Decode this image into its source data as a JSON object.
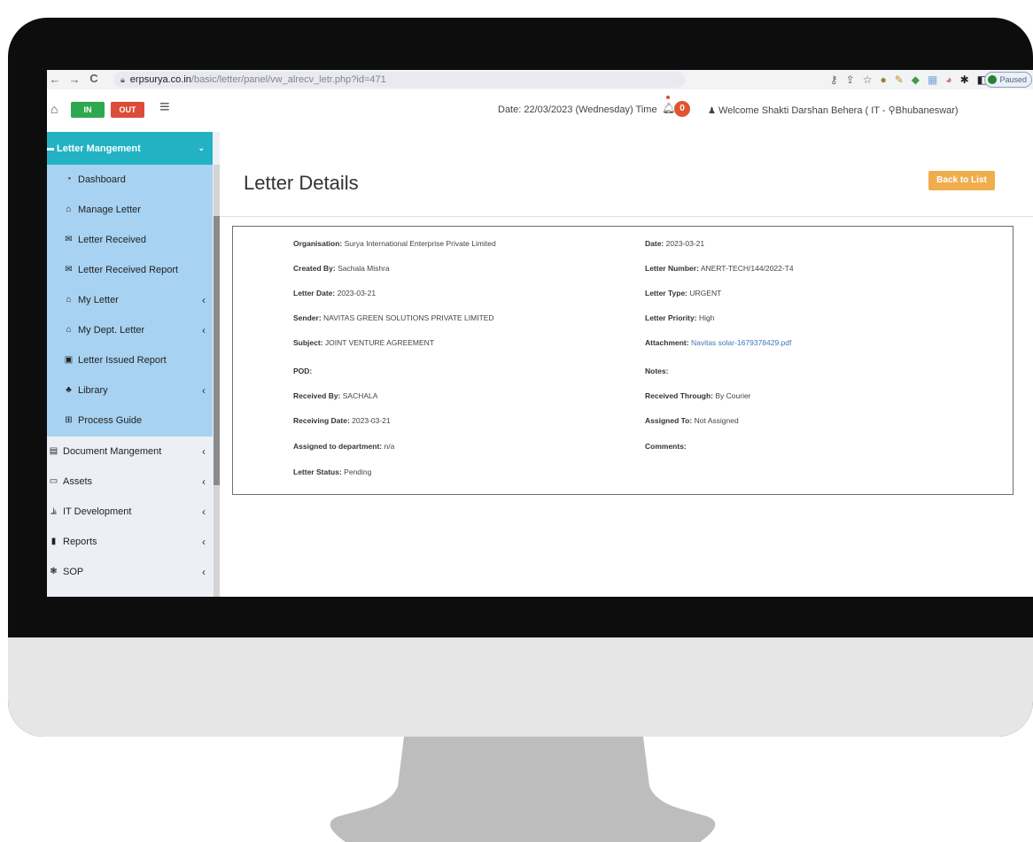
{
  "browser": {
    "url_domain": "erpsurya.co.in",
    "url_path": "/basic/letter/panel/vw_alrecv_letr.php?id=471",
    "profile_status": "Paused"
  },
  "header": {
    "in_label": "IN",
    "out_label": "OUT",
    "date_text": "Date: 22/03/2023 (Wednesday) Time",
    "notification_count": "0",
    "welcome_text": "Welcome Shakti Darshan Behera (  IT - ⚲Bhubaneswar)"
  },
  "sidebar": {
    "section_title": "Letter Mangement",
    "sub_items": [
      {
        "label": "Dashboard",
        "icon": "dashboard-icon",
        "has_chevron": false
      },
      {
        "label": "Manage Letter",
        "icon": "bank-icon",
        "has_chevron": false
      },
      {
        "label": "Letter Received",
        "icon": "envelope-icon",
        "has_chevron": false
      },
      {
        "label": "Letter Received Report",
        "icon": "envelope-icon",
        "has_chevron": false
      },
      {
        "label": "My Letter",
        "icon": "bank-icon",
        "has_chevron": true
      },
      {
        "label": "My Dept. Letter",
        "icon": "bank-icon",
        "has_chevron": true
      },
      {
        "label": "Letter Issued Report",
        "icon": "id-card-icon",
        "has_chevron": false
      },
      {
        "label": "Library",
        "icon": "users-icon",
        "has_chevron": true
      },
      {
        "label": "Process Guide",
        "icon": "table-icon",
        "has_chevron": false
      }
    ],
    "main_items": [
      {
        "label": "Document Mangement",
        "icon": "archive-icon"
      },
      {
        "label": "Assets",
        "icon": "desktop-icon"
      },
      {
        "label": "IT Development",
        "icon": "chart-icon"
      },
      {
        "label": "Reports",
        "icon": "file-icon"
      },
      {
        "label": "SOP",
        "icon": "gear-icon"
      }
    ]
  },
  "page": {
    "title": "Letter Details",
    "back_button": "Back to List"
  },
  "details": {
    "left": [
      {
        "label": "Organisation:",
        "value": "Surya International Enterprise Private Limited"
      },
      {
        "label": "Created By:",
        "value": "Sachala Mishra"
      },
      {
        "label": "Letter Date:",
        "value": "2023-03-21"
      },
      {
        "label": "Sender:",
        "value": "NAVITAS GREEN SOLUTIONS PRIVATE LIMITED"
      },
      {
        "label": "Subject:",
        "value": "JOINT VENTURE AGREEMENT"
      },
      {
        "label": "POD:",
        "value": ""
      },
      {
        "label": "Received By:",
        "value": "SACHALA"
      },
      {
        "label": "Receiving Date:",
        "value": "2023-03-21"
      },
      {
        "label": "Assigned to department:",
        "value": "n/a"
      },
      {
        "label": "Letter Status:",
        "value": "Pending"
      }
    ],
    "right": [
      {
        "label": "Date:",
        "value": "2023-03-21"
      },
      {
        "label": "Letter Number:",
        "value": "ANERT-TECH/144/2022-T4"
      },
      {
        "label": "Letter Type:",
        "value": "URGENT"
      },
      {
        "label": "Letter Priority:",
        "value": "High"
      },
      {
        "label": "Attachment:",
        "value": "Navitas solar-1679378429.pdf"
      },
      {
        "label": "Notes:",
        "value": ""
      },
      {
        "label": "Received Through:",
        "value": "By Courier"
      },
      {
        "label": "Assigned To:",
        "value": "Not Assigned"
      },
      {
        "label": "Comments:",
        "value": ""
      }
    ]
  },
  "colors": {
    "accent_teal": "#22b2c4",
    "submenu_blue": "#a7d2f1",
    "in_green": "#2ea84e",
    "out_red": "#dd4b39",
    "back_orange": "#f0ad4e",
    "link_blue": "#3c77b9"
  }
}
